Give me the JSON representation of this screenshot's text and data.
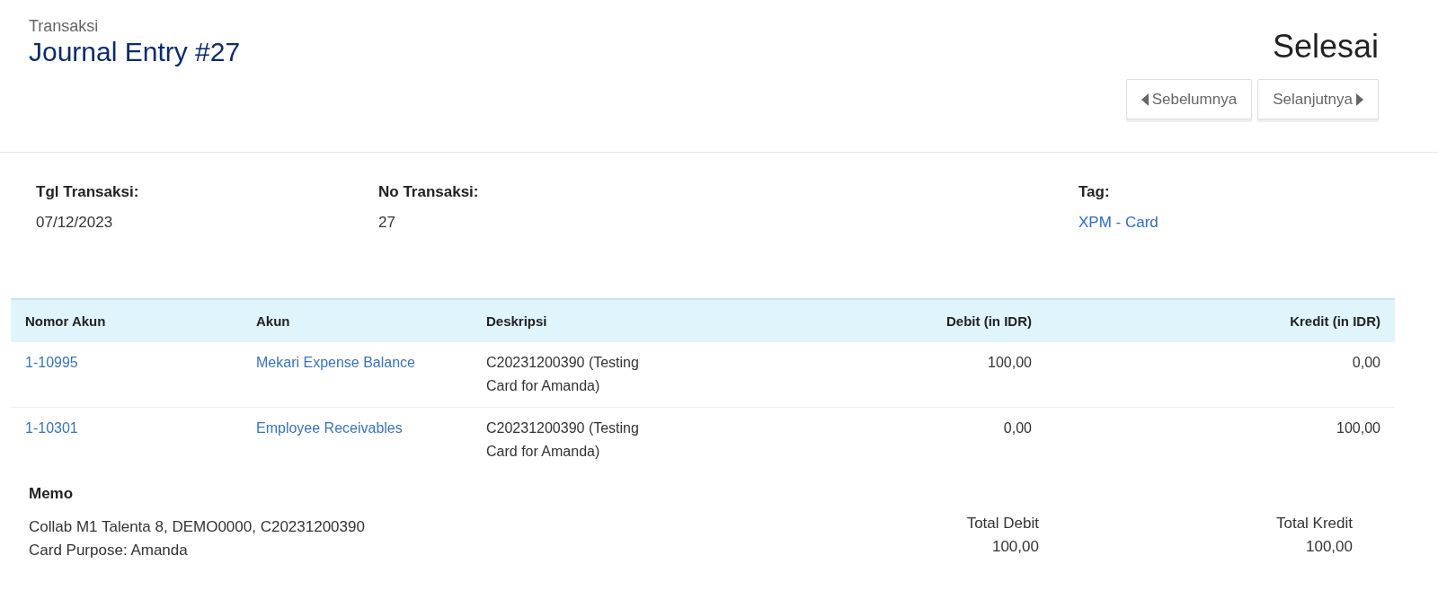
{
  "header": {
    "breadcrumb": "Transaksi",
    "title": "Journal Entry #27",
    "status": "Selesai"
  },
  "nav_buttons": [
    {
      "label": "Sebelumnya",
      "kind": "prev"
    },
    {
      "label": "Selanjutnya",
      "kind": "next"
    }
  ],
  "info": [
    {
      "label": "Tgl Transaksi:",
      "value": "07/12/2023",
      "kind": "text"
    },
    {
      "label": "No Transaksi:",
      "value": "27",
      "kind": "text"
    },
    {
      "label": "Tag:",
      "value": "XPM - Card",
      "kind": "link"
    }
  ],
  "table": {
    "columns": [
      "Nomor Akun",
      "Akun",
      "Deskripsi",
      "Debit (in IDR)",
      "Kredit (in IDR)"
    ],
    "rows": [
      {
        "account_no": "1-10995",
        "account": "Mekari Expense Balance",
        "description": "C20231200390 (Testing Card for Amanda)",
        "debit": "100,00",
        "credit": "0,00"
      },
      {
        "account_no": "1-10301",
        "account": "Employee Receivables",
        "description": "C20231200390 (Testing Card for Amanda)",
        "debit": "0,00",
        "credit": "100,00"
      }
    ]
  },
  "memo": {
    "label": "Memo",
    "lines": [
      "Collab M1 Talenta 8, DEMO0000, C20231200390",
      "Card Purpose: Amanda"
    ]
  },
  "totals": [
    {
      "label": "Total Debit",
      "value": "100,00"
    },
    {
      "label": "Total Kredit",
      "value": "100,00"
    }
  ]
}
